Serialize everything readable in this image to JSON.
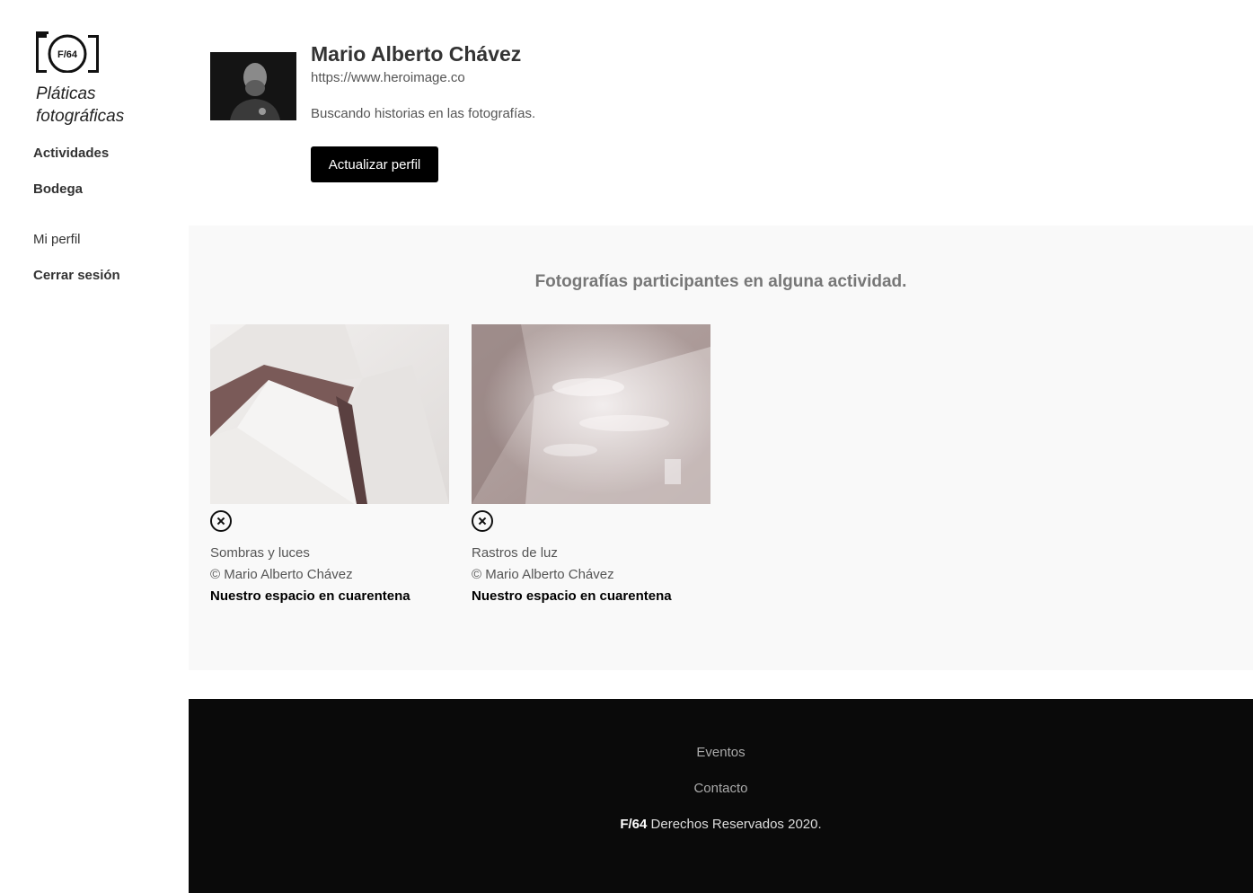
{
  "brand": {
    "logo_text": "F/64",
    "name": "Pláticas fotográficas"
  },
  "sidebar": {
    "items": [
      {
        "label": "Actividades"
      },
      {
        "label": "Bodega"
      },
      {
        "label": "Mi perfil"
      },
      {
        "label": "Cerrar sesión"
      }
    ]
  },
  "profile": {
    "name": "Mario Alberto Chávez",
    "url": "https://www.heroimage.co",
    "bio": "Buscando historias en las fotografías.",
    "update_button": "Actualizar perfil"
  },
  "gallery": {
    "title": "Fotografías participantes en alguna actividad.",
    "photos": [
      {
        "title": "Sombras y luces",
        "author": "© Mario Alberto Chávez",
        "activity": "Nuestro espacio en cuarentena"
      },
      {
        "title": "Rastros de luz",
        "author": "© Mario Alberto Chávez",
        "activity": "Nuestro espacio en cuarentena"
      }
    ]
  },
  "footer": {
    "links": [
      "Eventos",
      "Contacto"
    ],
    "brand": "F/64",
    "copyright": "Derechos Reservados 2020."
  },
  "colors": {
    "footer_bg": "#0a0a0a",
    "gallery_bg": "#f9f9f9",
    "button_bg": "#000000"
  }
}
